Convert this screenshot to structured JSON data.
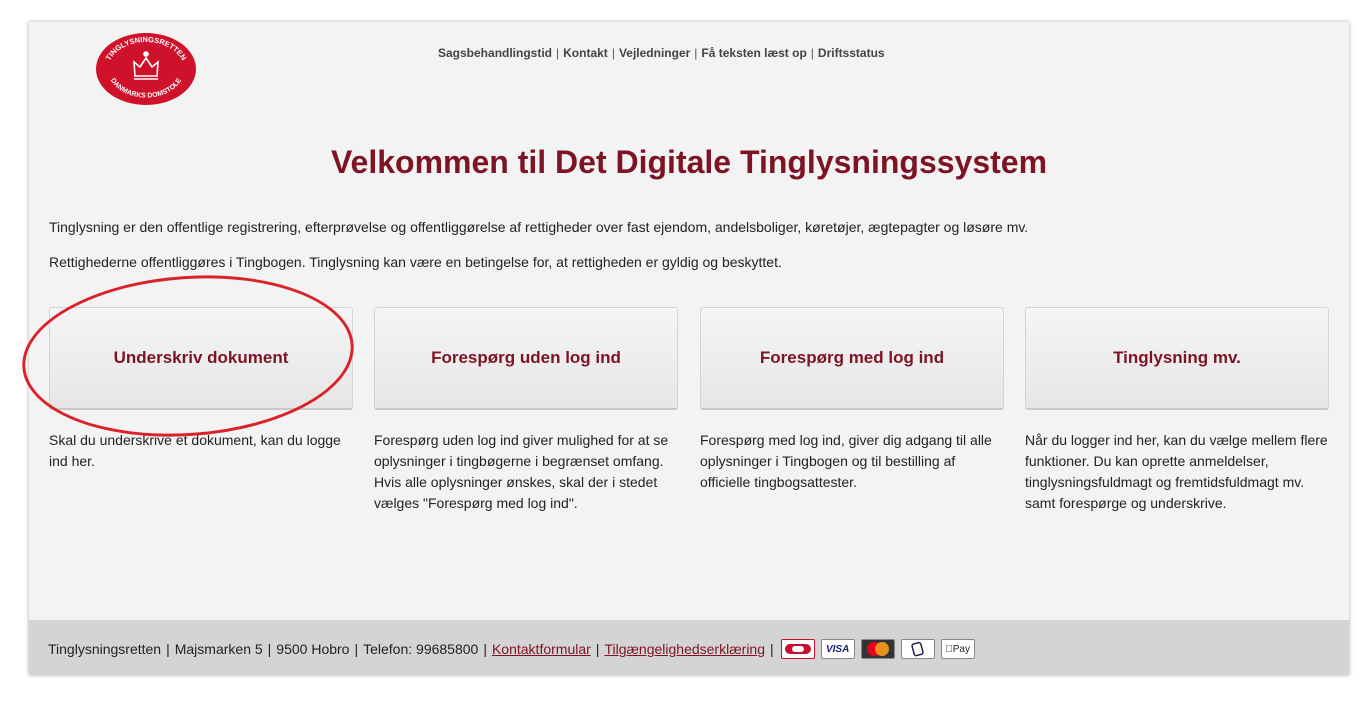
{
  "logo": {
    "text_top": "TINGLYSNINGSRETTEN",
    "text_bottom": "DANMARKS DOMSTOLE"
  },
  "topnav": {
    "items": [
      "Sagsbehandlingstid",
      "Kontakt",
      "Vejledninger",
      "Få teksten læst op",
      "Driftsstatus"
    ],
    "separator": "|"
  },
  "page": {
    "title": "Velkommen til Det Digitale Tinglysningssystem",
    "intro1": "Tinglysning er den offentlige registrering, efterprøvelse og offentliggørelse af rettigheder over fast ejendom, andelsboliger, køretøjer, ægtepagter og løsøre mv.",
    "intro2": "Rettighederne offentliggøres i Tingbogen. Tinglysning kan være en betingelse for, at rettigheden er gyldig og beskyttet."
  },
  "cards": [
    {
      "label": "Underskriv dokument",
      "desc": "Skal du underskrive et dokument, kan du logge ind her."
    },
    {
      "label": "Forespørg uden log ind",
      "desc": "Forespørg uden log ind giver mulighed for at se oplysninger i tingbøgerne i begrænset omfang. Hvis alle oplysninger ønskes, skal der i stedet vælges \"Forespørg med log ind\"."
    },
    {
      "label": "Forespørg med log ind",
      "desc": "Forespørg med log ind, giver dig adgang til alle oplysninger i Tingbogen og til bestilling af officielle tingbogsattester."
    },
    {
      "label": "Tinglysning mv.",
      "desc": "Når du logger ind her, kan du vælge mellem flere funktioner. Du kan oprette anmeldelser, tinglysningsfuldmagt og fremtidsfuldmagt mv. samt forespørge og underskrive."
    }
  ],
  "footer": {
    "org": "Tinglysningsretten",
    "address": "Majsmarken 5",
    "city": "9500 Hobro",
    "phone": "Telefon: 99685800",
    "contact_link": "Kontaktformular",
    "accessibility_link": "Tilgængelighedserklæring",
    "payment_icons": [
      "dankort-icon",
      "visa-icon",
      "mastercard-icon",
      "mobilepay-icon",
      "applepay-icon"
    ],
    "visa": "VISA",
    "applepay": "Pay",
    "mastercard": "MasterCard"
  },
  "colors": {
    "brand": "#7d1323",
    "annotation": "#d8232a",
    "footer_bg": "#d4d4d4",
    "page_bg": "#f3f3f3"
  }
}
